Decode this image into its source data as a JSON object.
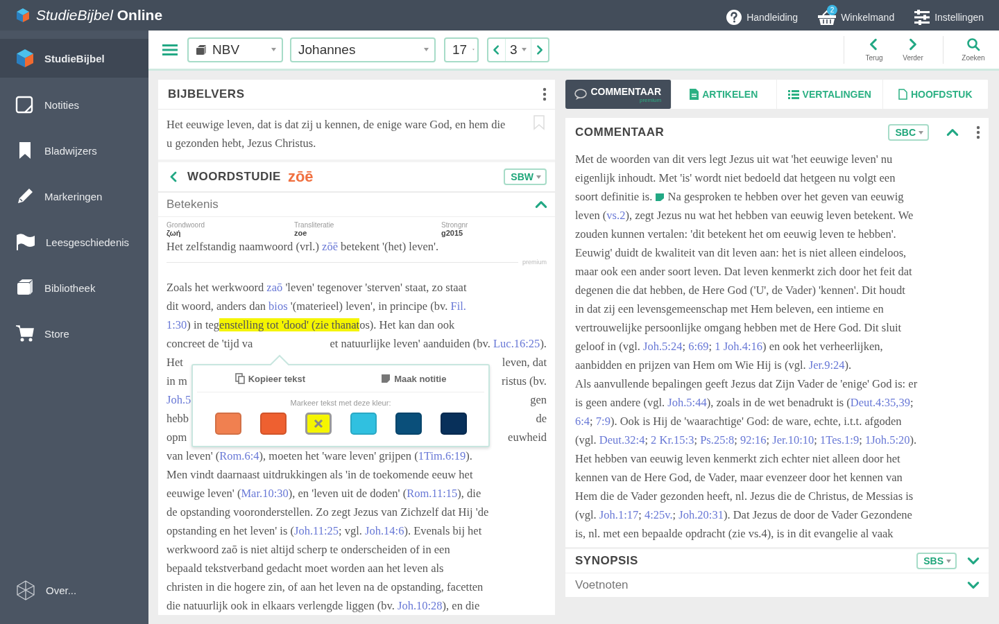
{
  "app_bar": {
    "title": "*StudieBijbel* **Online**",
    "actions": [
      {
        "kind": "help",
        "label": "Handleiding"
      },
      {
        "kind": "cart",
        "label": "Winkelmand",
        "badge": "2"
      },
      {
        "kind": "settings",
        "label": "Instellingen"
      }
    ]
  },
  "sidebar": {
    "items": [
      {
        "kind": "logo",
        "label": "StudieBijbel",
        "selected": true
      },
      {
        "kind": "notes",
        "label": "Notities",
        "selected": false
      },
      {
        "kind": "bookmarks",
        "label": "Bladwijzers",
        "selected": false
      },
      {
        "kind": "markings",
        "label": "Markeringen",
        "selected": false
      },
      {
        "kind": "history",
        "label": "Leesgeschiedenis",
        "selected": false
      },
      {
        "kind": "library",
        "label": "Bibliotheek",
        "selected": false
      },
      {
        "kind": "store",
        "label": "Store",
        "selected": false
      }
    ],
    "footer": {
      "kind": "about",
      "label": "Over..."
    }
  },
  "toolbar": {
    "translation": "NBV",
    "book": "Johannes",
    "chapter": "17",
    "verse": "3",
    "nav": [
      {
        "kind": "back",
        "label": "Terug"
      },
      {
        "kind": "forward",
        "label": "Verder"
      },
      {
        "kind": "search",
        "label": "Zoeken"
      }
    ]
  },
  "verse_panel": {
    "title": "BIJBELVERS",
    "verse": "Het eeuwige leven, dat is dat zij u kennen, de enige ware God, en hem die u gezonden hebt, Jezus Christus.",
    "word_study": {
      "title": "WOORDSTUDIE",
      "word": "zōē",
      "source": "SBW",
      "section": "Betekenis",
      "expanded": true,
      "fields": [
        {
          "label": "Grondwoord",
          "value": "ζωή"
        },
        {
          "label": "Transliteratie",
          "value": "zoe"
        },
        {
          "label": "Strongnr",
          "value": "g2015"
        }
      ],
      "definition": [
        {
          "kind": "text",
          "text": "Het zelfstandig naamwoord (vrl.) "
        },
        {
          "kind": "link",
          "text": "zōē"
        },
        {
          "kind": "text",
          "text": " betekent '(het) leven'."
        }
      ],
      "premium": "premium",
      "lines": [
        [
          {
            "kind": "text",
            "text": "Zoals het werkwoord "
          },
          {
            "kind": "link",
            "text": "zaō"
          },
          {
            "kind": "text",
            "text": " 'leven' tegenover 'sterven' staat, zo staat"
          }
        ],
        [
          {
            "kind": "text",
            "text": "dit woord, anders dan "
          },
          {
            "kind": "link",
            "text": "bios"
          },
          {
            "kind": "text",
            "text": " '(materieel) leven', in principe (bv. "
          },
          {
            "kind": "link",
            "text": "Fil."
          }
        ],
        [
          {
            "kind": "link",
            "text": "1:30"
          },
          {
            "kind": "text",
            "text": ") in teg"
          },
          {
            "kind": "highlight",
            "text": "enstelling tot 'dood' (zie thanat"
          },
          {
            "kind": "text",
            "text": "os). Het kan dan ook"
          }
        ],
        [
          {
            "kind": "text",
            "text": "concreet de 'tijd va"
          },
          {
            "kind": "covered"
          },
          {
            "kind": "text",
            "text": "et natuurlijke leven' aanduiden (bv. "
          },
          {
            "kind": "link",
            "text": "Luc.16:25"
          },
          {
            "kind": "text",
            "text": ")."
          }
        ],
        [
          {
            "kind": "text",
            "text": "Het"
          },
          {
            "kind": "covered"
          },
          {
            "kind": "text",
            "text": "leven, dat"
          }
        ],
        [
          {
            "kind": "text",
            "text": "in m"
          },
          {
            "kind": "covered"
          },
          {
            "kind": "text",
            "text": "ristus (bv."
          }
        ],
        [
          {
            "kind": "link",
            "text": "Joh.5"
          },
          {
            "kind": "covered"
          },
          {
            "kind": "text",
            "text": "gen"
          }
        ],
        [
          {
            "kind": "text",
            "text": "hebb"
          },
          {
            "kind": "covered"
          },
          {
            "kind": "text",
            "text": "de"
          }
        ],
        [
          {
            "kind": "text",
            "text": "opm"
          },
          {
            "kind": "covered"
          },
          {
            "kind": "text",
            "text": "euwheid"
          }
        ],
        [
          {
            "kind": "text",
            "text": "van leven' ("
          },
          {
            "kind": "link",
            "text": "Rom.6:4"
          },
          {
            "kind": "text",
            "text": "), moeten het 'ware leven' grijpen ("
          },
          {
            "kind": "link",
            "text": "1Tim.6:19"
          },
          {
            "kind": "text",
            "text": ")."
          }
        ],
        [
          {
            "kind": "text",
            "text": "Men vindt daarnaast uitdrukkingen als 'in de toekomende eeuw het"
          }
        ],
        [
          {
            "kind": "text",
            "text": "eeuwige leven' ("
          },
          {
            "kind": "link",
            "text": "Mar.10:30"
          },
          {
            "kind": "text",
            "text": "), en 'leven uit de doden' ("
          },
          {
            "kind": "link",
            "text": "Rom.11:15"
          },
          {
            "kind": "text",
            "text": "), die"
          }
        ],
        [
          {
            "kind": "text",
            "text": "de opstanding vooronderstellen. Zo zegt Jezus van Zichzelf dat Hij 'de"
          }
        ],
        [
          {
            "kind": "text",
            "text": "opstanding en het leven' is ("
          },
          {
            "kind": "link",
            "text": "Joh.11:25"
          },
          {
            "kind": "text",
            "text": "; vgl. "
          },
          {
            "kind": "link",
            "text": "Joh.14:6"
          },
          {
            "kind": "text",
            "text": "). Evenals bij het"
          }
        ],
        [
          {
            "kind": "text",
            "text": "werkwoord zaō is niet altijd scherp te onderscheiden of in een"
          }
        ],
        [
          {
            "kind": "text",
            "text": "bepaald tekstverband gedacht moet worden aan het leven als"
          }
        ],
        [
          {
            "kind": "text",
            "text": "christen in die hogere zin, of aan het leven na de opstanding, facetten"
          }
        ],
        [
          {
            "kind": "text",
            "text": "die natuurlijk ook in elkaars verlengde liggen (bv. "
          },
          {
            "kind": "link",
            "text": "Joh.10:28"
          },
          {
            "kind": "text",
            "text": "), en die"
          }
        ]
      ]
    }
  },
  "popup": {
    "actions": [
      {
        "kind": "copy",
        "label": "Kopieer tekst"
      },
      {
        "kind": "note",
        "label": "Maak notitie"
      }
    ],
    "label": "Markeer tekst met deze kleur:",
    "swatches": [
      {
        "color": "#f08050",
        "selected": false
      },
      {
        "color": "#ee6030",
        "selected": false
      },
      {
        "color": "#f5f500",
        "selected": true
      },
      {
        "color": "#30c0e0",
        "selected": false
      },
      {
        "color": "#0a4f7a",
        "selected": false
      },
      {
        "color": "#08305a",
        "selected": false
      }
    ]
  },
  "tabs": [
    {
      "kind": "comment",
      "label": "COMMENTAAR",
      "badge": "premium",
      "selected": true
    },
    {
      "kind": "articles",
      "label": "ARTIKELEN",
      "selected": false
    },
    {
      "kind": "translations",
      "label": "VERTALINGEN",
      "selected": false
    },
    {
      "kind": "chapter",
      "label": "HOOFDSTUK",
      "selected": false
    }
  ],
  "commentary": {
    "title": "COMMENTAAR",
    "source": "SBC",
    "expanded": true,
    "lines": [
      [
        {
          "kind": "text",
          "text": "Met de woorden van dit vers legt Jezus uit wat 'het eeuwige leven' nu"
        }
      ],
      [
        {
          "kind": "text",
          "text": "eigenlijk inhoudt. Met 'is' wordt niet bedoeld dat hetgeen nu volgt een"
        }
      ],
      [
        {
          "kind": "text",
          "text": "soort definitie is. "
        },
        {
          "kind": "note"
        },
        {
          "kind": "text",
          "text": " Na gesproken te hebben over het geven van eeuwig"
        }
      ],
      [
        {
          "kind": "text",
          "text": "leven ("
        },
        {
          "kind": "link",
          "text": "vs.2"
        },
        {
          "kind": "text",
          "text": "), zegt Jezus nu wat het hebben van eeuwig leven betekent. We"
        }
      ],
      [
        {
          "kind": "text",
          "text": "zouden kunnen vertalen: 'dit betekent het om eeuwig leven te hebben'."
        }
      ],
      [
        {
          "kind": "text",
          "text": "Eeuwig' duidt de kwaliteit van dit leven aan: het is niet alleen eindeloos,"
        }
      ],
      [
        {
          "kind": "text",
          "text": "maar ook een ander soort leven. Dat leven kenmerkt zich door het feit dat"
        }
      ],
      [
        {
          "kind": "text",
          "text": "degenen die dat hebben, de Here God ('U', de Vader) 'kennen'. Dit houdt"
        }
      ],
      [
        {
          "kind": "text",
          "text": "in dat zij een levensgemeenschap met Hem beleven, een intieme en"
        }
      ],
      [
        {
          "kind": "text",
          "text": "vertrouwelijke persoonlijke omgang hebben met de Here God. Dit sluit"
        }
      ],
      [
        {
          "kind": "text",
          "text": "geloof in (vgl. "
        },
        {
          "kind": "link",
          "text": "Joh.5:24"
        },
        {
          "kind": "text",
          "text": "; "
        },
        {
          "kind": "link",
          "text": "6:69"
        },
        {
          "kind": "text",
          "text": "; "
        },
        {
          "kind": "link",
          "text": "1 Joh.4:16"
        },
        {
          "kind": "text",
          "text": ") en ook het verheerlijken,"
        }
      ],
      [
        {
          "kind": "text",
          "text": "aanbidden en prijzen van Hem om Wie Hij is (vgl. "
        },
        {
          "kind": "link",
          "text": "Jer.9:24"
        },
        {
          "kind": "text",
          "text": ")."
        }
      ],
      [
        {
          "kind": "text",
          "text": "Als aanvullende bepalingen geeft Jezus dat Zijn Vader de 'enige' God is: er"
        }
      ],
      [
        {
          "kind": "text",
          "text": "is geen andere (vgl. "
        },
        {
          "kind": "link",
          "text": "Joh.5:44"
        },
        {
          "kind": "text",
          "text": "), zoals in de wet benadrukt is ("
        },
        {
          "kind": "link",
          "text": "Deut.4:35,39"
        },
        {
          "kind": "text",
          "text": ";"
        }
      ],
      [
        {
          "kind": "link",
          "text": "6:4"
        },
        {
          "kind": "text",
          "text": "; "
        },
        {
          "kind": "link",
          "text": "7:9"
        },
        {
          "kind": "text",
          "text": "). Ook is Hij de 'waarachtige' God: de ware, echte, i.t.t. afgoden"
        }
      ],
      [
        {
          "kind": "text",
          "text": "(vgl. "
        },
        {
          "kind": "link",
          "text": "Deut.32:4"
        },
        {
          "kind": "text",
          "text": "; "
        },
        {
          "kind": "link",
          "text": "2 Kr.15:3"
        },
        {
          "kind": "text",
          "text": "; "
        },
        {
          "kind": "link",
          "text": "Ps.25:8"
        },
        {
          "kind": "text",
          "text": "; "
        },
        {
          "kind": "link",
          "text": "92:16"
        },
        {
          "kind": "text",
          "text": "; "
        },
        {
          "kind": "link",
          "text": "Jer.10:10"
        },
        {
          "kind": "text",
          "text": "; "
        },
        {
          "kind": "link",
          "text": "1Tes.1:9"
        },
        {
          "kind": "text",
          "text": "; "
        },
        {
          "kind": "link",
          "text": "1Joh.5:20"
        },
        {
          "kind": "text",
          "text": ")."
        }
      ],
      [
        {
          "kind": "text",
          "text": "Het hebben van eeuwig leven kenmerkt zich echter niet alleen door het"
        }
      ],
      [
        {
          "kind": "text",
          "text": "kennen van de Here God, de Vader, maar evenzeer door het kennen van"
        }
      ],
      [
        {
          "kind": "text",
          "text": "Hem die de Vader gezonden heeft, nl. Jezus die de Christus, de Messias is"
        }
      ],
      [
        {
          "kind": "text",
          "text": "(vgl. "
        },
        {
          "kind": "link",
          "text": "Joh.1:17"
        },
        {
          "kind": "text",
          "text": "; "
        },
        {
          "kind": "link",
          "text": "4:25v."
        },
        {
          "kind": "text",
          "text": "; "
        },
        {
          "kind": "link",
          "text": "Joh.20:31"
        },
        {
          "kind": "text",
          "text": "). Dat Jezus de door de Vader Gezondene"
        }
      ],
      [
        {
          "kind": "text",
          "text": "is, nl. met een bepaalde opdracht (zie vs.4), is in dit evangelie al vaak"
        }
      ]
    ]
  },
  "synopsis": {
    "title": "SYNOPSIS",
    "source": "SBS",
    "expanded": false
  },
  "footnotes": {
    "title": "Voetnoten",
    "expanded": false
  }
}
